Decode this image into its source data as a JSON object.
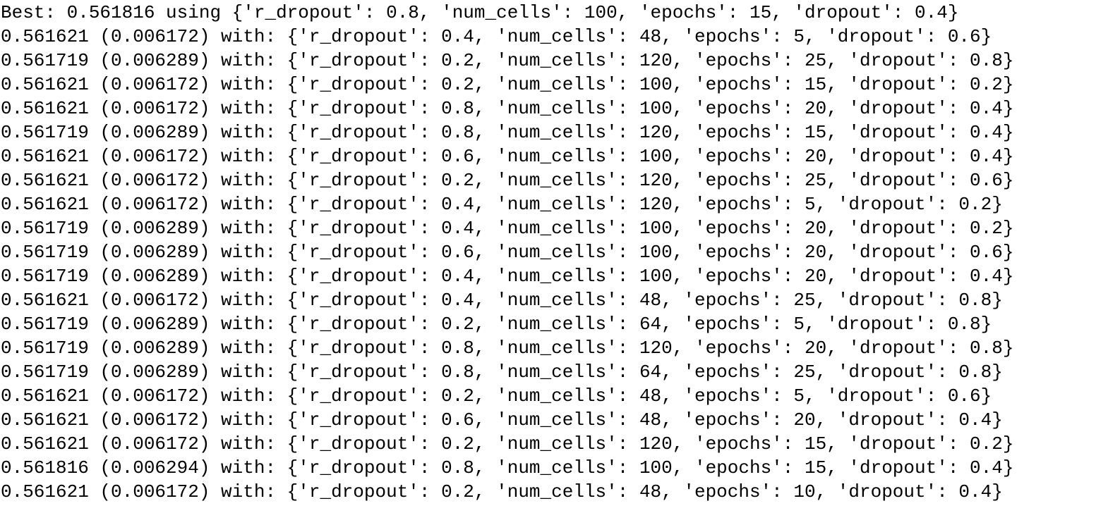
{
  "output": {
    "best": "Best: 0.561816 using {'r_dropout': 0.8, 'num_cells': 100, 'epochs': 15, 'dropout': 0.4}",
    "results": [
      "0.561621 (0.006172) with: {'r_dropout': 0.4, 'num_cells': 48, 'epochs': 5, 'dropout': 0.6}",
      "0.561719 (0.006289) with: {'r_dropout': 0.2, 'num_cells': 120, 'epochs': 25, 'dropout': 0.8}",
      "0.561621 (0.006172) with: {'r_dropout': 0.2, 'num_cells': 100, 'epochs': 15, 'dropout': 0.2}",
      "0.561621 (0.006172) with: {'r_dropout': 0.8, 'num_cells': 100, 'epochs': 20, 'dropout': 0.4}",
      "0.561719 (0.006289) with: {'r_dropout': 0.8, 'num_cells': 120, 'epochs': 15, 'dropout': 0.4}",
      "0.561621 (0.006172) with: {'r_dropout': 0.6, 'num_cells': 100, 'epochs': 20, 'dropout': 0.4}",
      "0.561621 (0.006172) with: {'r_dropout': 0.2, 'num_cells': 120, 'epochs': 25, 'dropout': 0.6}",
      "0.561621 (0.006172) with: {'r_dropout': 0.4, 'num_cells': 120, 'epochs': 5, 'dropout': 0.2}",
      "0.561719 (0.006289) with: {'r_dropout': 0.4, 'num_cells': 100, 'epochs': 20, 'dropout': 0.2}",
      "0.561719 (0.006289) with: {'r_dropout': 0.6, 'num_cells': 100, 'epochs': 20, 'dropout': 0.6}",
      "0.561719 (0.006289) with: {'r_dropout': 0.4, 'num_cells': 100, 'epochs': 20, 'dropout': 0.4}",
      "0.561621 (0.006172) with: {'r_dropout': 0.4, 'num_cells': 48, 'epochs': 25, 'dropout': 0.8}",
      "0.561719 (0.006289) with: {'r_dropout': 0.2, 'num_cells': 64, 'epochs': 5, 'dropout': 0.8}",
      "0.561719 (0.006289) with: {'r_dropout': 0.8, 'num_cells': 120, 'epochs': 20, 'dropout': 0.8}",
      "0.561719 (0.006289) with: {'r_dropout': 0.8, 'num_cells': 64, 'epochs': 25, 'dropout': 0.8}",
      "0.561621 (0.006172) with: {'r_dropout': 0.2, 'num_cells': 48, 'epochs': 5, 'dropout': 0.6}",
      "0.561621 (0.006172) with: {'r_dropout': 0.6, 'num_cells': 48, 'epochs': 20, 'dropout': 0.4}",
      "0.561621 (0.006172) with: {'r_dropout': 0.2, 'num_cells': 120, 'epochs': 15, 'dropout': 0.2}",
      "0.561816 (0.006294) with: {'r_dropout': 0.8, 'num_cells': 100, 'epochs': 15, 'dropout': 0.4}",
      "0.561621 (0.006172) with: {'r_dropout': 0.2, 'num_cells': 48, 'epochs': 10, 'dropout': 0.4}"
    ]
  }
}
